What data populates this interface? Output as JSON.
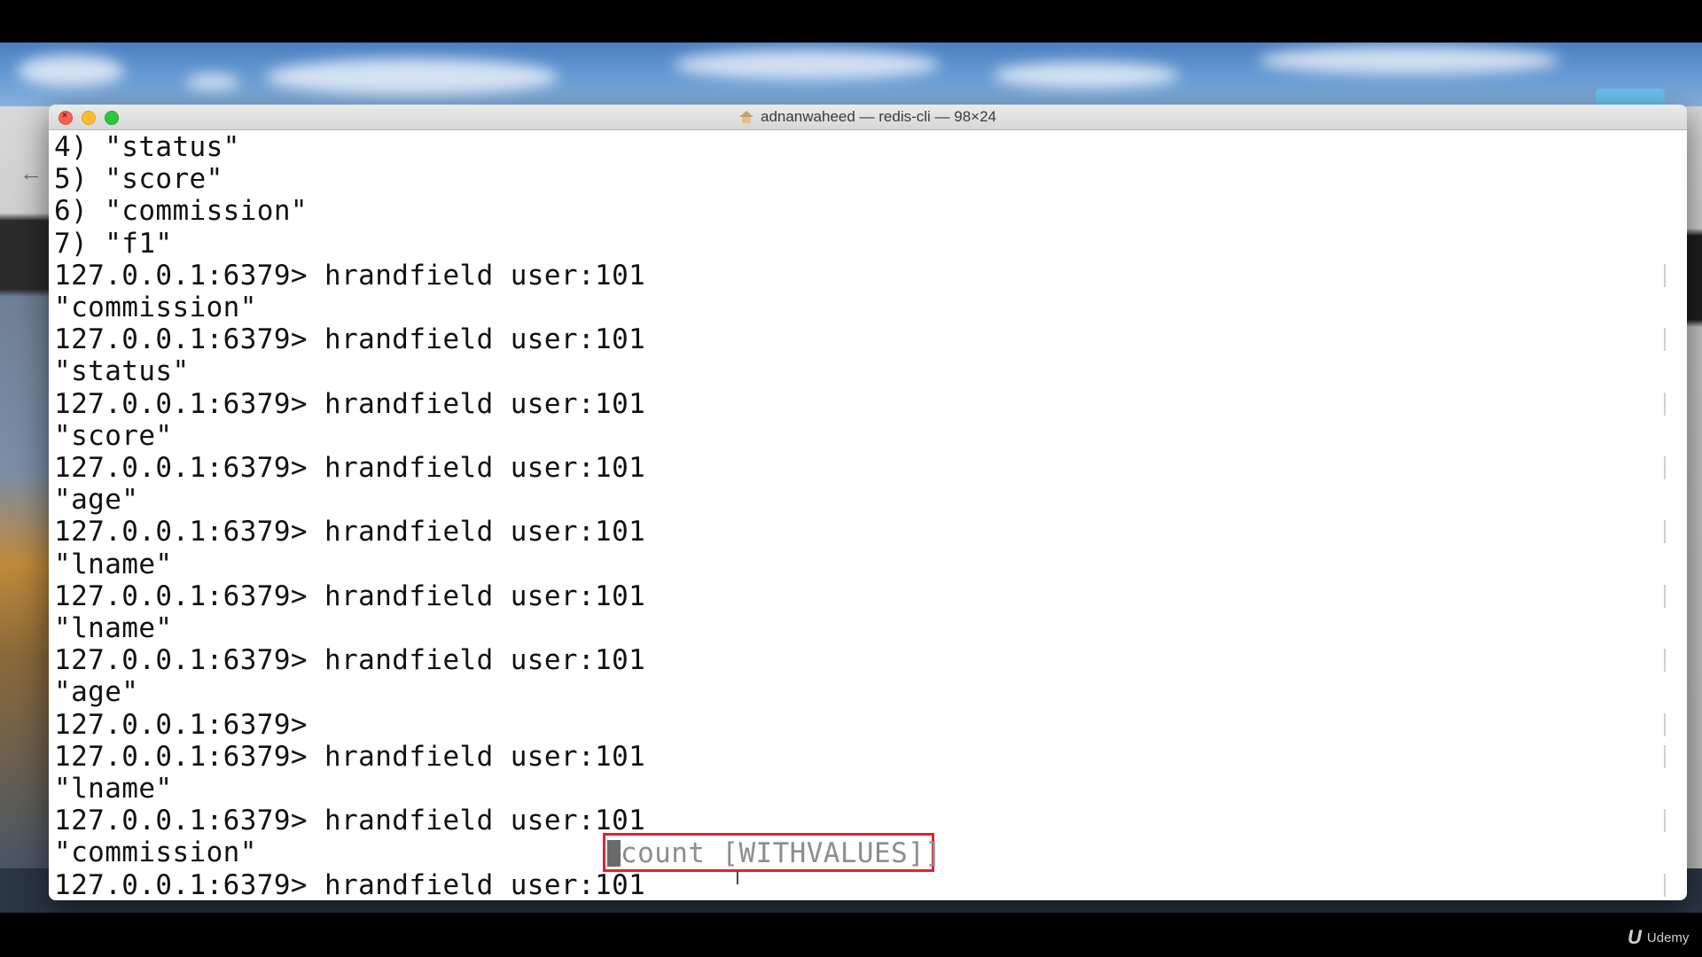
{
  "window": {
    "title": "adnanwaheed — redis-cli — 98×24",
    "home_icon": "home-icon"
  },
  "terminal": {
    "lines": [
      "4) \"status\"",
      "5) \"score\"",
      "6) \"commission\"",
      "7) \"f1\"",
      "127.0.0.1:6379> hrandfield user:101",
      "\"commission\"",
      "127.0.0.1:6379> hrandfield user:101",
      "\"status\"",
      "127.0.0.1:6379> hrandfield user:101",
      "\"score\"",
      "127.0.0.1:6379> hrandfield user:101",
      "\"age\"",
      "127.0.0.1:6379> hrandfield user:101",
      "\"lname\"",
      "127.0.0.1:6379> hrandfield user:101",
      "\"lname\"",
      "127.0.0.1:6379> hrandfield user:101",
      "\"age\"",
      "127.0.0.1:6379>",
      "127.0.0.1:6379> hrandfield user:101",
      "\"lname\"",
      "127.0.0.1:6379> hrandfield user:101",
      "\"commission\"",
      "127.0.0.1:6379> hrandfield user:101"
    ],
    "hint": "count [WITHVALUES]]",
    "highlight_color": "#e4222b"
  },
  "watermark": {
    "logo": "U",
    "label": "Udemy"
  }
}
